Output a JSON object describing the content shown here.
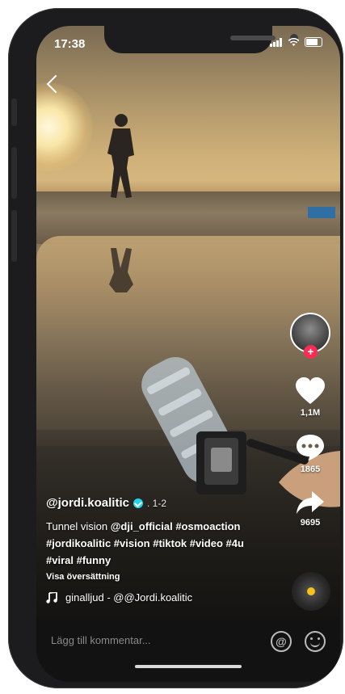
{
  "status_bar": {
    "time": "17:38"
  },
  "video": {
    "author": "@jordi.koalitic",
    "date_suffix": ". 1-2",
    "description_prefix": "Tunnel vision ",
    "description_mention": "@dji_official",
    "description_tags_1": " #osmoaction",
    "description_tags_2": "#jordikoalitic #vision #tiktok #video #4u",
    "description_tags_3": "#viral #funny",
    "translate_label": "Visa översättning",
    "music": "ginalljud - @@Jordi.koalitic"
  },
  "actions": {
    "likes": "1,1M",
    "comments": "1865",
    "shares": "9695"
  },
  "comment_bar": {
    "placeholder": "Lägg till kommentar..."
  },
  "icons": [
    "back-icon",
    "heart-icon",
    "comment-icon",
    "share-icon",
    "music-note-icon",
    "at-icon",
    "emoji-icon",
    "verified-icon",
    "follow-plus-icon"
  ],
  "colors": {
    "accent": "#fe2c55",
    "verified": "#20d5ec",
    "disc_dot": "#f4c21a"
  }
}
